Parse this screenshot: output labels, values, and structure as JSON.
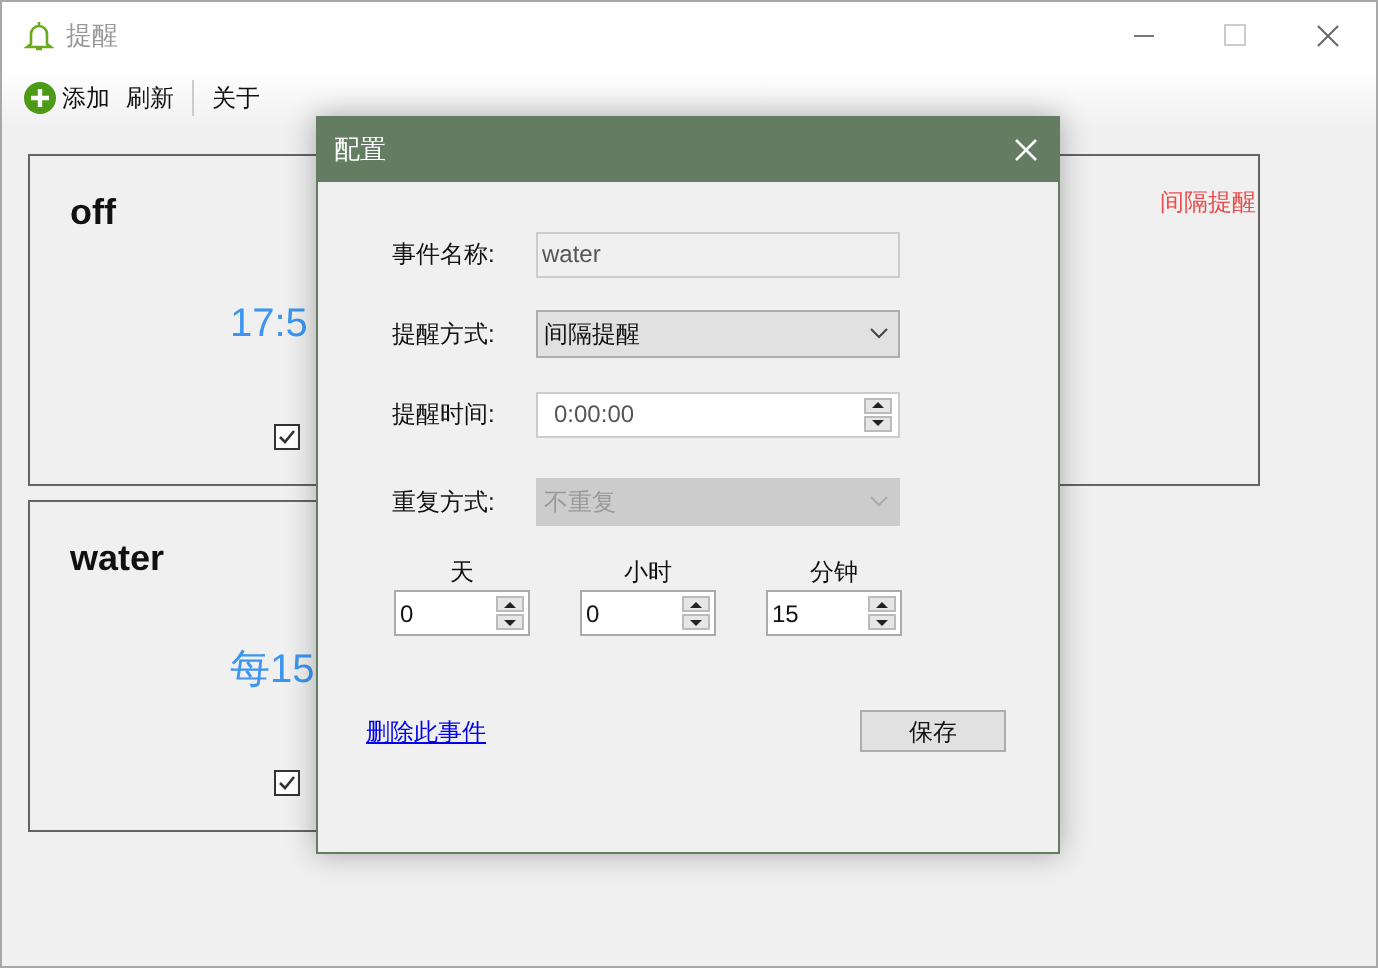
{
  "window": {
    "title": "提醒"
  },
  "toolbar": [
    {
      "kind": "add",
      "label": "添加",
      "separator_before": false
    },
    {
      "kind": "plain",
      "label": "刷新",
      "separator_before": false
    },
    {
      "kind": "plain",
      "label": "关于",
      "separator_before": true
    }
  ],
  "cards": [
    {
      "name": "off",
      "time": "17:5",
      "tag": "间隔提醒",
      "checked": true
    },
    {
      "name": "water",
      "time": "每15",
      "checked": true
    }
  ],
  "dialog": {
    "title": "配置",
    "fields": [
      {
        "kind": "text",
        "label": "事件名称:",
        "value": "water",
        "disabled": true
      },
      {
        "kind": "select",
        "label": "提醒方式:",
        "value": "间隔提醒",
        "disabled": false
      },
      {
        "kind": "time",
        "label": "提醒时间:",
        "value": "0:00:00",
        "disabled": false
      },
      {
        "kind": "select",
        "label": "重复方式:",
        "value": "不重复",
        "disabled": true
      }
    ],
    "intervals": [
      {
        "label": "天",
        "value": "0"
      },
      {
        "label": "小时",
        "value": "0"
      },
      {
        "label": "分钟",
        "value": "15"
      }
    ],
    "delete_link": "删除此事件",
    "save_button": "保存"
  }
}
